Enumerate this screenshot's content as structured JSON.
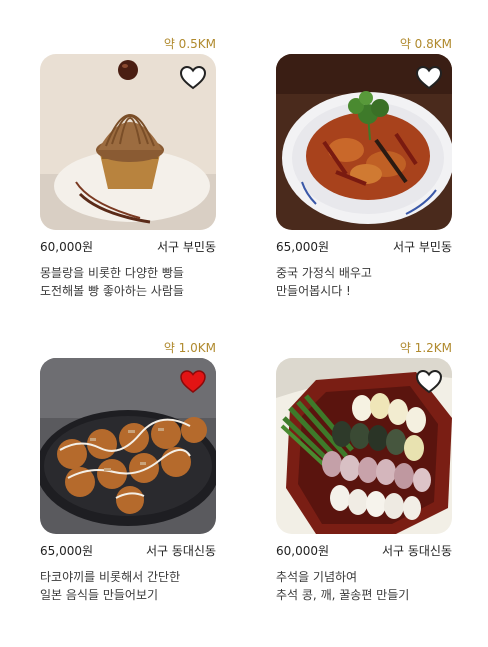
{
  "cards": [
    {
      "distance": "약 0.5KM",
      "price": "60,000원",
      "location": "서구 부민동",
      "desc_line1": "몽블랑을 비롯한 다양한 빵들",
      "desc_line2": "도전해볼 빵 좋아하는 사람들",
      "liked": false,
      "image": "mont-blanc-pastry"
    },
    {
      "distance": "약 0.8KM",
      "price": "65,000원",
      "location": "서구 부민동",
      "desc_line1": "중국 가정식 배우고",
      "desc_line2": "만들어봅시다 !",
      "liked": false,
      "image": "chinese-stir-fry"
    },
    {
      "distance": "약 1.0KM",
      "price": "65,000원",
      "location": "서구 동대신동",
      "desc_line1": "타코야끼를 비롯해서 간단한",
      "desc_line2": "일본 음식들 만들어보기",
      "liked": true,
      "image": "takoyaki"
    },
    {
      "distance": "약  1.2KM",
      "price": "60,000원",
      "location": "서구 동대신동",
      "desc_line1": "추석을 기념하여",
      "desc_line2": "추석 콩, 깨, 꿀송편 만들기",
      "liked": false,
      "image": "songpyeon"
    }
  ],
  "colors": {
    "distance": "#b08a2e",
    "heart_liked": "#e31414",
    "heart_unliked": "#ffffff"
  }
}
